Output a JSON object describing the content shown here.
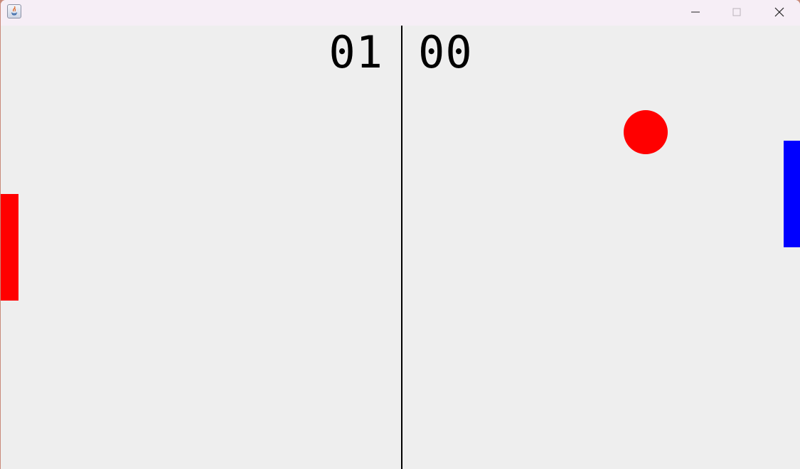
{
  "scoreboard": {
    "left_score": "01",
    "right_score": "00"
  },
  "titlebar": {
    "app_icon": "java-app-icon",
    "minimize_icon": "minimize-icon",
    "maximize_icon": "maximize-icon",
    "close_icon": "close-icon"
  },
  "colors": {
    "court_background": "#eeeeee",
    "net": "#000000",
    "left_paddle": "#ff0000",
    "right_paddle": "#0000ff",
    "ball": "#ff0000",
    "score_text": "#000000"
  }
}
